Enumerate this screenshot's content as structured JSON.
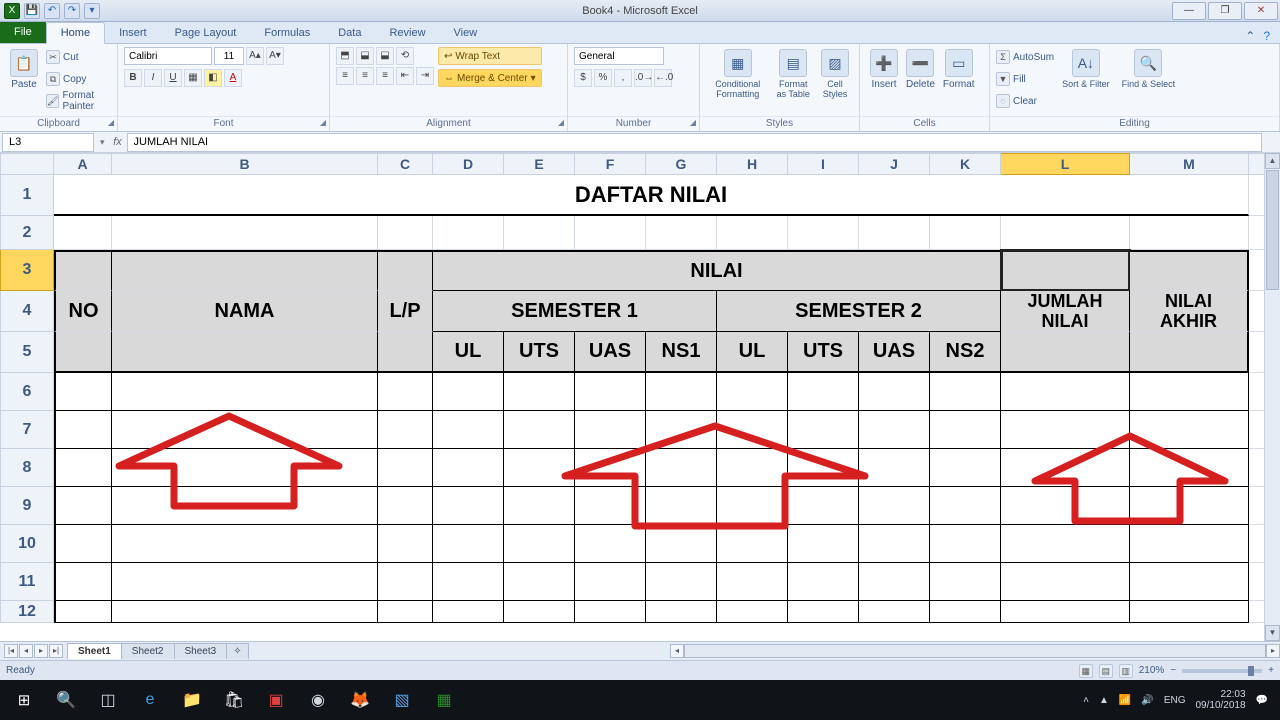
{
  "title": "Book4 - Microsoft Excel",
  "tabs": {
    "file": "File",
    "home": "Home",
    "insert": "Insert",
    "pagelayout": "Page Layout",
    "formulas": "Formulas",
    "data": "Data",
    "review": "Review",
    "view": "View"
  },
  "clipboard": {
    "cut": "Cut",
    "copy": "Copy",
    "fp": "Format Painter",
    "paste": "Paste",
    "label": "Clipboard"
  },
  "font": {
    "name": "Calibri",
    "size": "11",
    "label": "Font"
  },
  "alignment": {
    "wrap": "Wrap Text",
    "merge": "Merge & Center",
    "label": "Alignment"
  },
  "number": {
    "fmt": "General",
    "label": "Number"
  },
  "styles": {
    "cf": "Conditional Formatting",
    "fat": "Format as Table",
    "cs": "Cell Styles",
    "label": "Styles"
  },
  "cells": {
    "ins": "Insert",
    "del": "Delete",
    "fmt": "Format",
    "label": "Cells"
  },
  "editing": {
    "sum": "AutoSum",
    "fill": "Fill",
    "clear": "Clear",
    "sort": "Sort & Filter",
    "find": "Find & Select",
    "label": "Editing"
  },
  "namebox": "L3",
  "formula": "JUMLAH NILAI",
  "cols": [
    "A",
    "B",
    "C",
    "D",
    "E",
    "F",
    "G",
    "H",
    "I",
    "J",
    "K",
    "L",
    "M"
  ],
  "rows": [
    "1",
    "2",
    "3",
    "4",
    "5",
    "6",
    "7",
    "8",
    "9",
    "10",
    "11",
    "12"
  ],
  "table": {
    "title": "DAFTAR NILAI",
    "no": "NO",
    "nama": "NAMA",
    "lp": "L/P",
    "nilai": "NILAI",
    "sem1": "SEMESTER 1",
    "sem2": "SEMESTER 2",
    "ul": "UL",
    "uts": "UTS",
    "uas": "UAS",
    "ns1": "NS1",
    "ns2": "NS2",
    "jumlah": "JUMLAH NILAI",
    "akhir": "NILAI AKHIR"
  },
  "sheets": {
    "s1": "Sheet1",
    "s2": "Sheet2",
    "s3": "Sheet3"
  },
  "status": {
    "ready": "Ready",
    "zoom": "210%",
    "lang": "ENG"
  },
  "clock": {
    "time": "22:03",
    "date": "09/10/2018"
  }
}
